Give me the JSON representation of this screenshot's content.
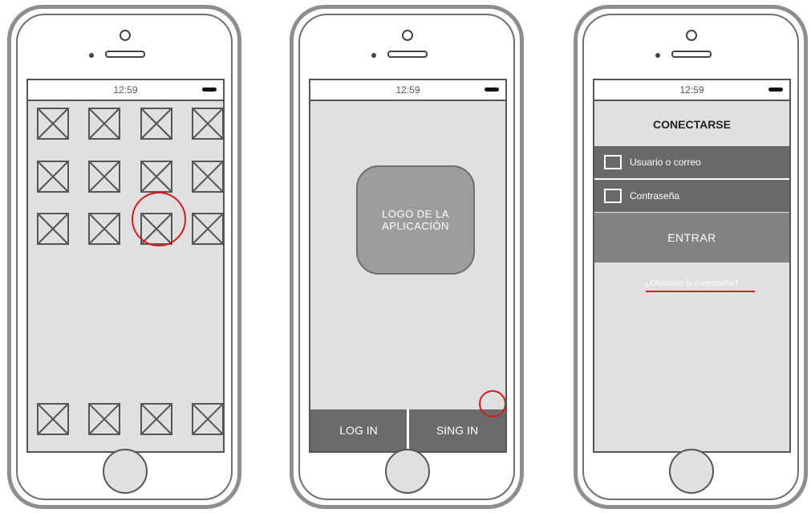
{
  "statusbar": {
    "time": "12:59"
  },
  "screen1": {
    "icon_name": "image-placeholder-icon",
    "grid_rows": 3,
    "grid_cols": 4,
    "dock_count": 4,
    "highlight_row": 3,
    "highlight_col": 3
  },
  "screen2": {
    "logo_line1": "LOGO DE LA",
    "logo_line2": "APLICACIÓN",
    "login_label": "LOG IN",
    "signin_label": "SING IN"
  },
  "screen3": {
    "title": "CONECTARSE",
    "user_field": "Usuario o correo",
    "password_field": "Contraseña",
    "enter_label": "ENTRAR",
    "forgot_link": "¿Olvidaste la contraseña?"
  },
  "colors": {
    "highlight": "#d71a1a",
    "frame": "#8e8e90",
    "screen_bg": "#e0e0e1",
    "dark_button": "#6b6a6c"
  }
}
